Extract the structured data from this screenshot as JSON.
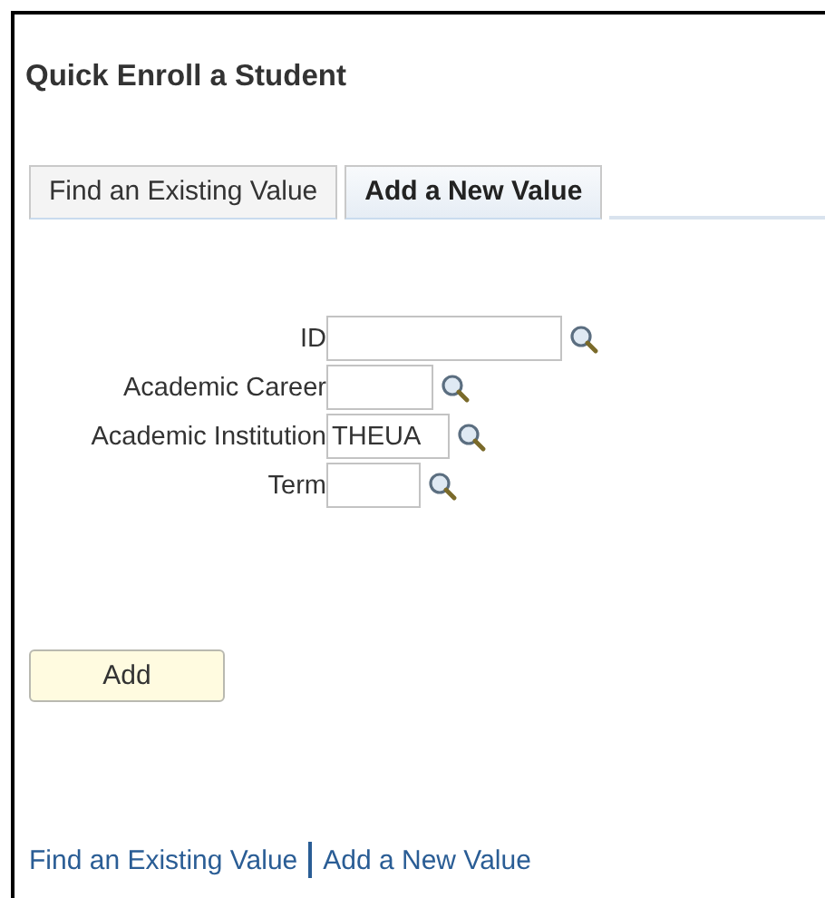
{
  "page_title": "Quick Enroll a Student",
  "tabs": [
    {
      "label": "Find an Existing Value",
      "selected": false
    },
    {
      "label": "Add a New Value",
      "selected": true
    }
  ],
  "fields": [
    {
      "label": "ID"
    },
    {
      "label": "Academic Career"
    },
    {
      "label": "Academic Institution",
      "value": "THEUA"
    },
    {
      "label": "Term"
    }
  ],
  "add_button": "Add",
  "footer_links": [
    "Find an Existing Value",
    "Add a New Value"
  ]
}
